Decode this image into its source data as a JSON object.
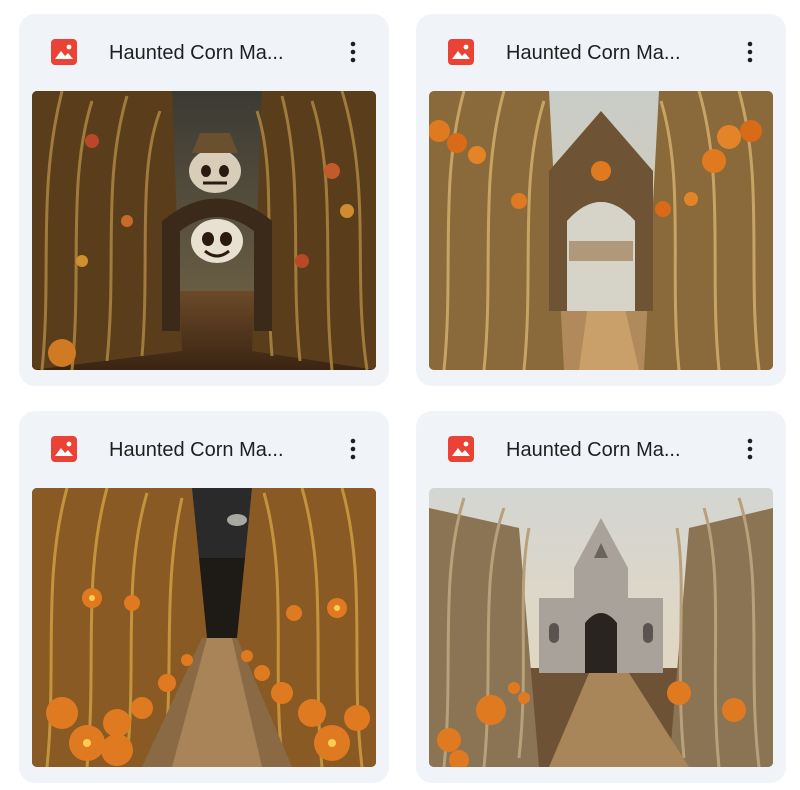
{
  "files": [
    {
      "title": "Haunted Corn Ma...",
      "icon": "image-file-icon",
      "icon_color": "#ea4335"
    },
    {
      "title": "Haunted Corn Ma...",
      "icon": "image-file-icon",
      "icon_color": "#ea4335"
    },
    {
      "title": "Haunted Corn Ma...",
      "icon": "image-file-icon",
      "icon_color": "#ea4335"
    },
    {
      "title": "Haunted Corn Ma...",
      "icon": "image-file-icon",
      "icon_color": "#ea4335"
    }
  ],
  "more_menu_icon": "more-vert-icon"
}
